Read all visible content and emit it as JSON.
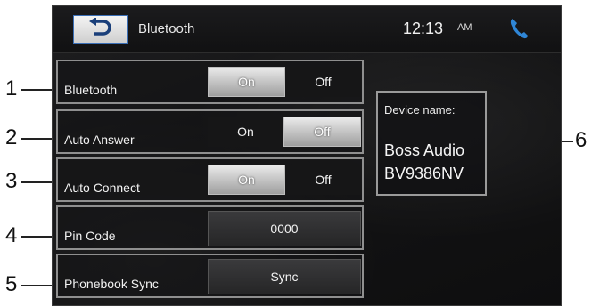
{
  "header": {
    "title": "Bluetooth",
    "time": "12:13",
    "ampm": "AM"
  },
  "settings": [
    {
      "label": "Bluetooth",
      "options": [
        "On",
        "Off"
      ],
      "selected": "On"
    },
    {
      "label": "Auto Answer",
      "options": [
        "On",
        "Off"
      ],
      "selected": "Off"
    },
    {
      "label": "Auto Connect",
      "options": [
        "On",
        "Off"
      ],
      "selected": "On"
    },
    {
      "label": "Pin Code",
      "value": "0000"
    },
    {
      "label": "Phonebook Sync",
      "button": "Sync"
    }
  ],
  "device": {
    "label": "Device name:",
    "name_line1": "Boss Audio",
    "name_line2": "BV9386NV"
  },
  "callouts": [
    "1",
    "2",
    "3",
    "4",
    "5",
    "6"
  ],
  "colors": {
    "accent": "#3b6fb6",
    "phone_icon": "#2f86d6"
  },
  "icons": {
    "back": "back-arrow-icon",
    "phone": "phone-icon"
  }
}
